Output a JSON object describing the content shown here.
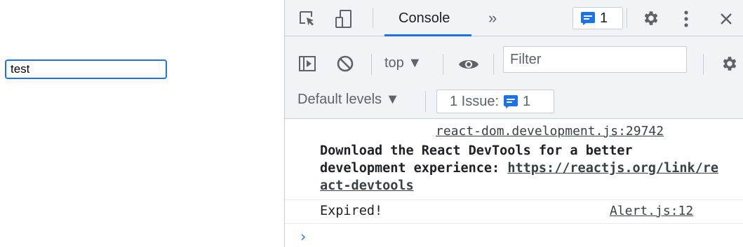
{
  "page": {
    "input_value": "test"
  },
  "devtools": {
    "tabs": {
      "active": "Console",
      "more": "»"
    },
    "issues_badge_count": "1",
    "toolbar": {
      "context": "top ▼",
      "filter_placeholder": "Filter"
    },
    "levels": {
      "label": "Default levels ▼",
      "issues_label": "1 Issue:",
      "issues_count": "1"
    },
    "messages": [
      {
        "source": "react-dom.development.js:29742",
        "text_prefix": "Download the React DevTools for a better development experience: ",
        "link": "https://reactjs.org/link/react-devtools"
      },
      {
        "text": "Expired!",
        "source": "Alert.js:12"
      }
    ],
    "prompt": "›"
  },
  "colors": {
    "accent": "#1a73e8",
    "toolbar_bg": "#f1f3f4",
    "border": "#cacdd1"
  },
  "icons": [
    "inspect-element-icon",
    "device-toolbar-icon",
    "more-tabs-icon",
    "message-icon",
    "gear-icon",
    "kebab-menu-icon",
    "close-icon",
    "sidebar-toggle-icon",
    "clear-console-icon",
    "eye-icon"
  ]
}
